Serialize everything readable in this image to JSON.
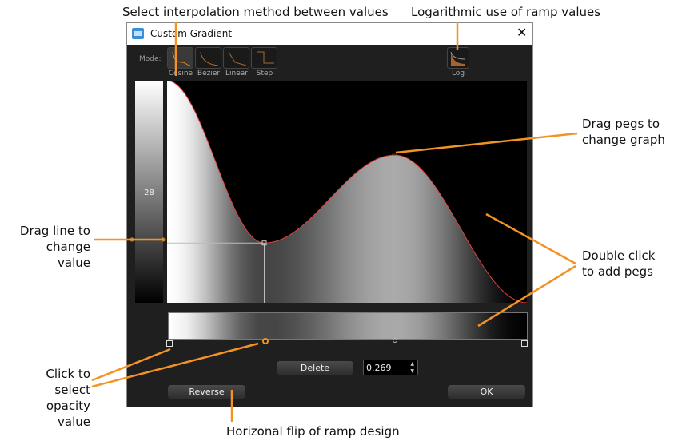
{
  "window": {
    "title": "Custom Gradient",
    "close_icon": "close-icon"
  },
  "toolbar": {
    "mode_label": "Mode:",
    "modes": [
      {
        "label": "Cosine",
        "selected": true
      },
      {
        "label": "Bezier"
      },
      {
        "label": "Linear"
      },
      {
        "label": "Step"
      }
    ],
    "log_label": "Log"
  },
  "value_bar": {
    "value": "28"
  },
  "graph": {
    "interpolation": "cosine",
    "pegs": [
      {
        "position": 0,
        "value": 1
      },
      {
        "position": 0.27,
        "value": 0.269,
        "selected": true
      },
      {
        "position": 0.633,
        "value": 0.665
      },
      {
        "position": 1,
        "value": 0
      }
    ],
    "curve_color": "#e04040"
  },
  "controls": {
    "delete_label": "Delete",
    "value": "0.269",
    "reverse_label": "Reverse",
    "ok_label": "OK"
  },
  "annotations": {
    "interp": "Select interpolation method between values",
    "log": "Logarithmic use of ramp values",
    "drag_pegs": [
      "Drag pegs to",
      "change graph"
    ],
    "drag_line": [
      "Drag line to",
      "change value"
    ],
    "double_click": [
      "Double click",
      "to add pegs"
    ],
    "click_select": [
      "Click to select",
      "opacity value"
    ],
    "flip": "Horizonal flip of ramp design",
    "color": "#f39325"
  }
}
